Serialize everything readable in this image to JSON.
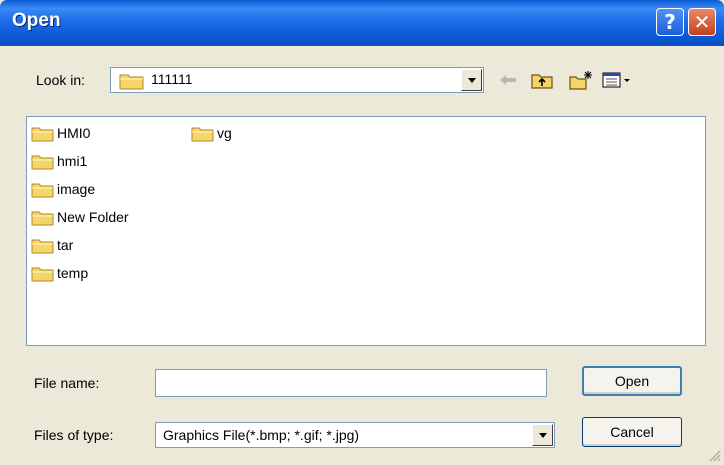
{
  "window": {
    "title": "Open"
  },
  "lookin": {
    "label": "Look in:",
    "value": "111111"
  },
  "files": {
    "items": [
      {
        "name": "HMI0"
      },
      {
        "name": "hmi1"
      },
      {
        "name": "image"
      },
      {
        "name": "New Folder"
      },
      {
        "name": "tar"
      },
      {
        "name": "temp"
      },
      {
        "name": "vg"
      }
    ]
  },
  "filename": {
    "label": "File name:",
    "value": ""
  },
  "filetype": {
    "label": "Files of type:",
    "value": "Graphics File(*.bmp; *.gif; *.jpg)"
  },
  "buttons": {
    "open": "Open",
    "cancel": "Cancel"
  },
  "colors": {
    "titlebar": "#0a5bd5",
    "face": "#ece9d8",
    "folder": "#f5d46a"
  }
}
